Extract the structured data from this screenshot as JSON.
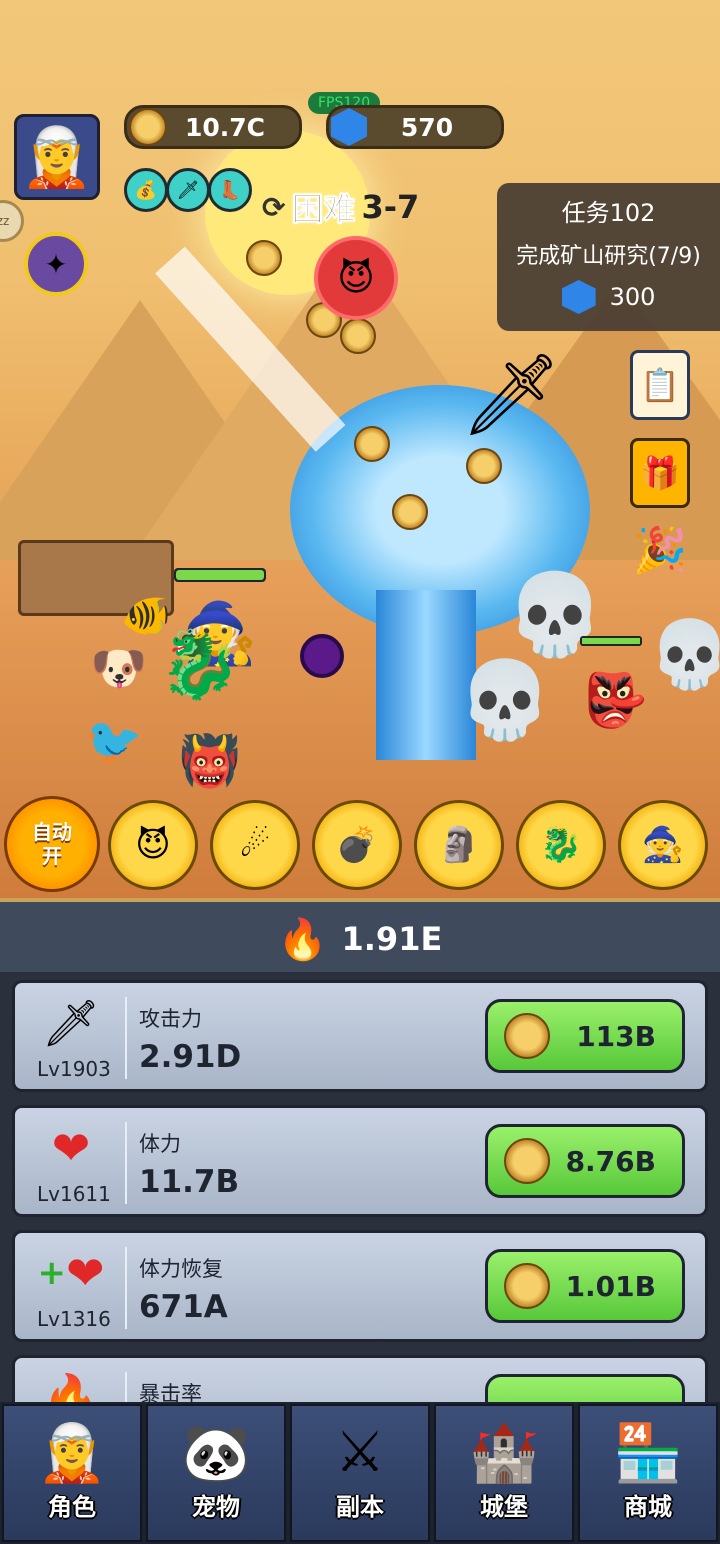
{
  "hud": {
    "gold": "10.7C",
    "gems": "570",
    "fps": "FPS120",
    "stage_difficulty": "困难",
    "stage_level": "3-7"
  },
  "task": {
    "title": "任务102",
    "description": "完成矿山研究(7/9)",
    "reward": "300"
  },
  "skills": {
    "auto_label_1": "自动",
    "auto_label_2": "开"
  },
  "power": {
    "value": "1.91E"
  },
  "upgrades": [
    {
      "name": "攻击力",
      "level": "Lv1903",
      "value": "2.91D",
      "cost": "113B",
      "icon": "sword-icon"
    },
    {
      "name": "体力",
      "level": "Lv1611",
      "value": "11.7B",
      "cost": "8.76B",
      "icon": "heart-icon"
    },
    {
      "name": "体力恢复",
      "level": "Lv1316",
      "value": "671A",
      "cost": "1.01B",
      "icon": "heart-plus-icon"
    },
    {
      "name": "暴击率",
      "level": "",
      "value": "",
      "cost": "",
      "icon": "crit-icon"
    }
  ],
  "nav": [
    {
      "label": "角色",
      "icon": "hero-icon"
    },
    {
      "label": "宠物",
      "icon": "panda-icon"
    },
    {
      "label": "副本",
      "icon": "crossed-swords-icon"
    },
    {
      "label": "城堡",
      "icon": "castle-icon"
    },
    {
      "label": "商城",
      "icon": "shop-icon"
    }
  ],
  "colors": {
    "buy_green": "#58c83a",
    "panel_bg": "#2a313d",
    "nav_tab": "#2b3a5c",
    "skill_gold": "#ffd84a"
  }
}
